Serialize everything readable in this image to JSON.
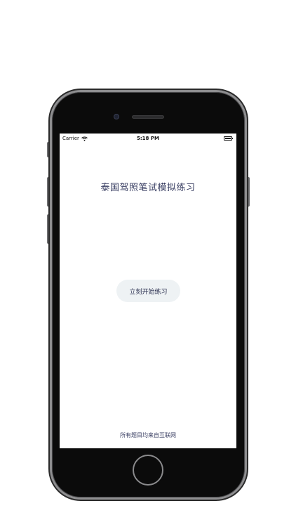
{
  "status_bar": {
    "carrier": "Carrier",
    "time": "5:18 PM",
    "wifi_icon": "wifi-icon",
    "battery_icon": "battery-full-icon"
  },
  "main": {
    "title": "泰国驾照笔试模拟练习",
    "start_button_label": "立刻开始练习",
    "footer_note": "所有题目均来自互联网"
  },
  "colors": {
    "title_text": "#3a3f63",
    "button_bg": "#eef2f4",
    "phone_body": "#0b0b0b"
  }
}
